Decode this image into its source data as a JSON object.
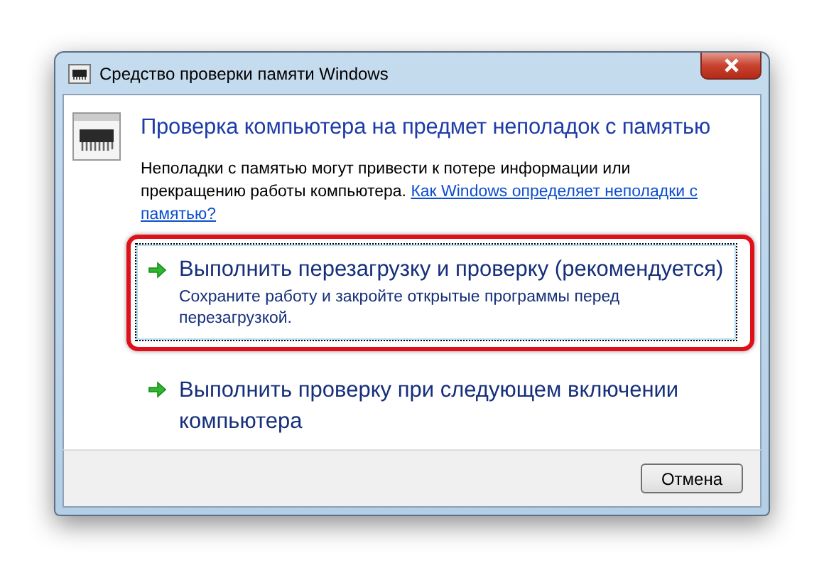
{
  "window": {
    "title": "Средство проверки памяти Windows"
  },
  "heading": "Проверка компьютера на предмет неполадок с памятью",
  "description": {
    "text": "Неполадки с памятью могут привести к потере информации или прекращению работы компьютера.",
    "link_lines": [
      "Как Windows определяет неполадки с",
      "памятью?"
    ]
  },
  "options": [
    {
      "title": "Выполнить перезагрузку и проверку (рекомендуется)",
      "note": "Сохраните работу и закройте открытые программы перед перезагрузкой.",
      "selected": true
    },
    {
      "title": "Выполнить проверку при следующем включении компьютера",
      "selected": false
    }
  ],
  "buttons": [
    "Отмена"
  ]
}
